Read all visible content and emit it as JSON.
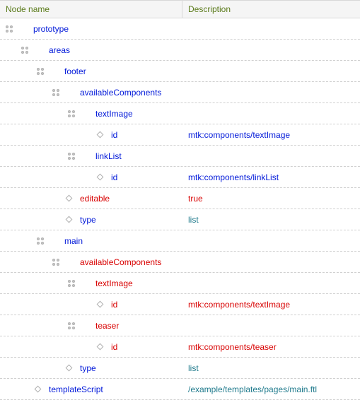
{
  "columns": {
    "name": "Node name",
    "desc": "Description"
  },
  "rows": [
    {
      "depth": 0,
      "handle": true,
      "diamond": false,
      "label": "prototype",
      "color": "blue",
      "desc": ""
    },
    {
      "depth": 1,
      "handle": true,
      "diamond": false,
      "label": "areas",
      "color": "blue",
      "desc": ""
    },
    {
      "depth": 2,
      "handle": true,
      "diamond": false,
      "label": "footer",
      "color": "blue",
      "desc": ""
    },
    {
      "depth": 3,
      "handle": true,
      "diamond": false,
      "label": "availableComponents",
      "color": "blue",
      "desc": ""
    },
    {
      "depth": 4,
      "handle": true,
      "diamond": false,
      "label": "textImage",
      "color": "blue",
      "desc": ""
    },
    {
      "depth": 5,
      "handle": false,
      "diamond": true,
      "label": "id",
      "color": "blue",
      "desc": "mtk:components/textImage",
      "desc_color": "blue"
    },
    {
      "depth": 4,
      "handle": true,
      "diamond": false,
      "label": "linkList",
      "color": "blue",
      "desc": ""
    },
    {
      "depth": 5,
      "handle": false,
      "diamond": true,
      "label": "id",
      "color": "blue",
      "desc": "mtk:components/linkList",
      "desc_color": "blue"
    },
    {
      "depth": 3,
      "handle": false,
      "diamond": true,
      "label": "editable",
      "color": "red",
      "desc": "true",
      "desc_color": "red"
    },
    {
      "depth": 3,
      "handle": false,
      "diamond": true,
      "label": "type",
      "color": "blue",
      "desc": "list",
      "desc_color": "teal"
    },
    {
      "depth": 2,
      "handle": true,
      "diamond": false,
      "label": "main",
      "color": "blue",
      "desc": ""
    },
    {
      "depth": 3,
      "handle": true,
      "diamond": false,
      "label": "availableComponents",
      "color": "red",
      "desc": ""
    },
    {
      "depth": 4,
      "handle": true,
      "diamond": false,
      "label": "textImage",
      "color": "red",
      "desc": ""
    },
    {
      "depth": 5,
      "handle": false,
      "diamond": true,
      "label": "id",
      "color": "red",
      "desc": "mtk:components/textImage",
      "desc_color": "red"
    },
    {
      "depth": 4,
      "handle": true,
      "diamond": false,
      "label": "teaser",
      "color": "red",
      "desc": ""
    },
    {
      "depth": 5,
      "handle": false,
      "diamond": true,
      "label": "id",
      "color": "red",
      "desc": "mtk:components/teaser",
      "desc_color": "red"
    },
    {
      "depth": 3,
      "handle": false,
      "diamond": true,
      "label": "type",
      "color": "blue",
      "desc": "list",
      "desc_color": "teal"
    },
    {
      "depth": 1,
      "handle": false,
      "diamond": true,
      "label": "templateScript",
      "color": "blue",
      "desc": "/example/templates/pages/main.ftl",
      "desc_color": "teal"
    }
  ]
}
